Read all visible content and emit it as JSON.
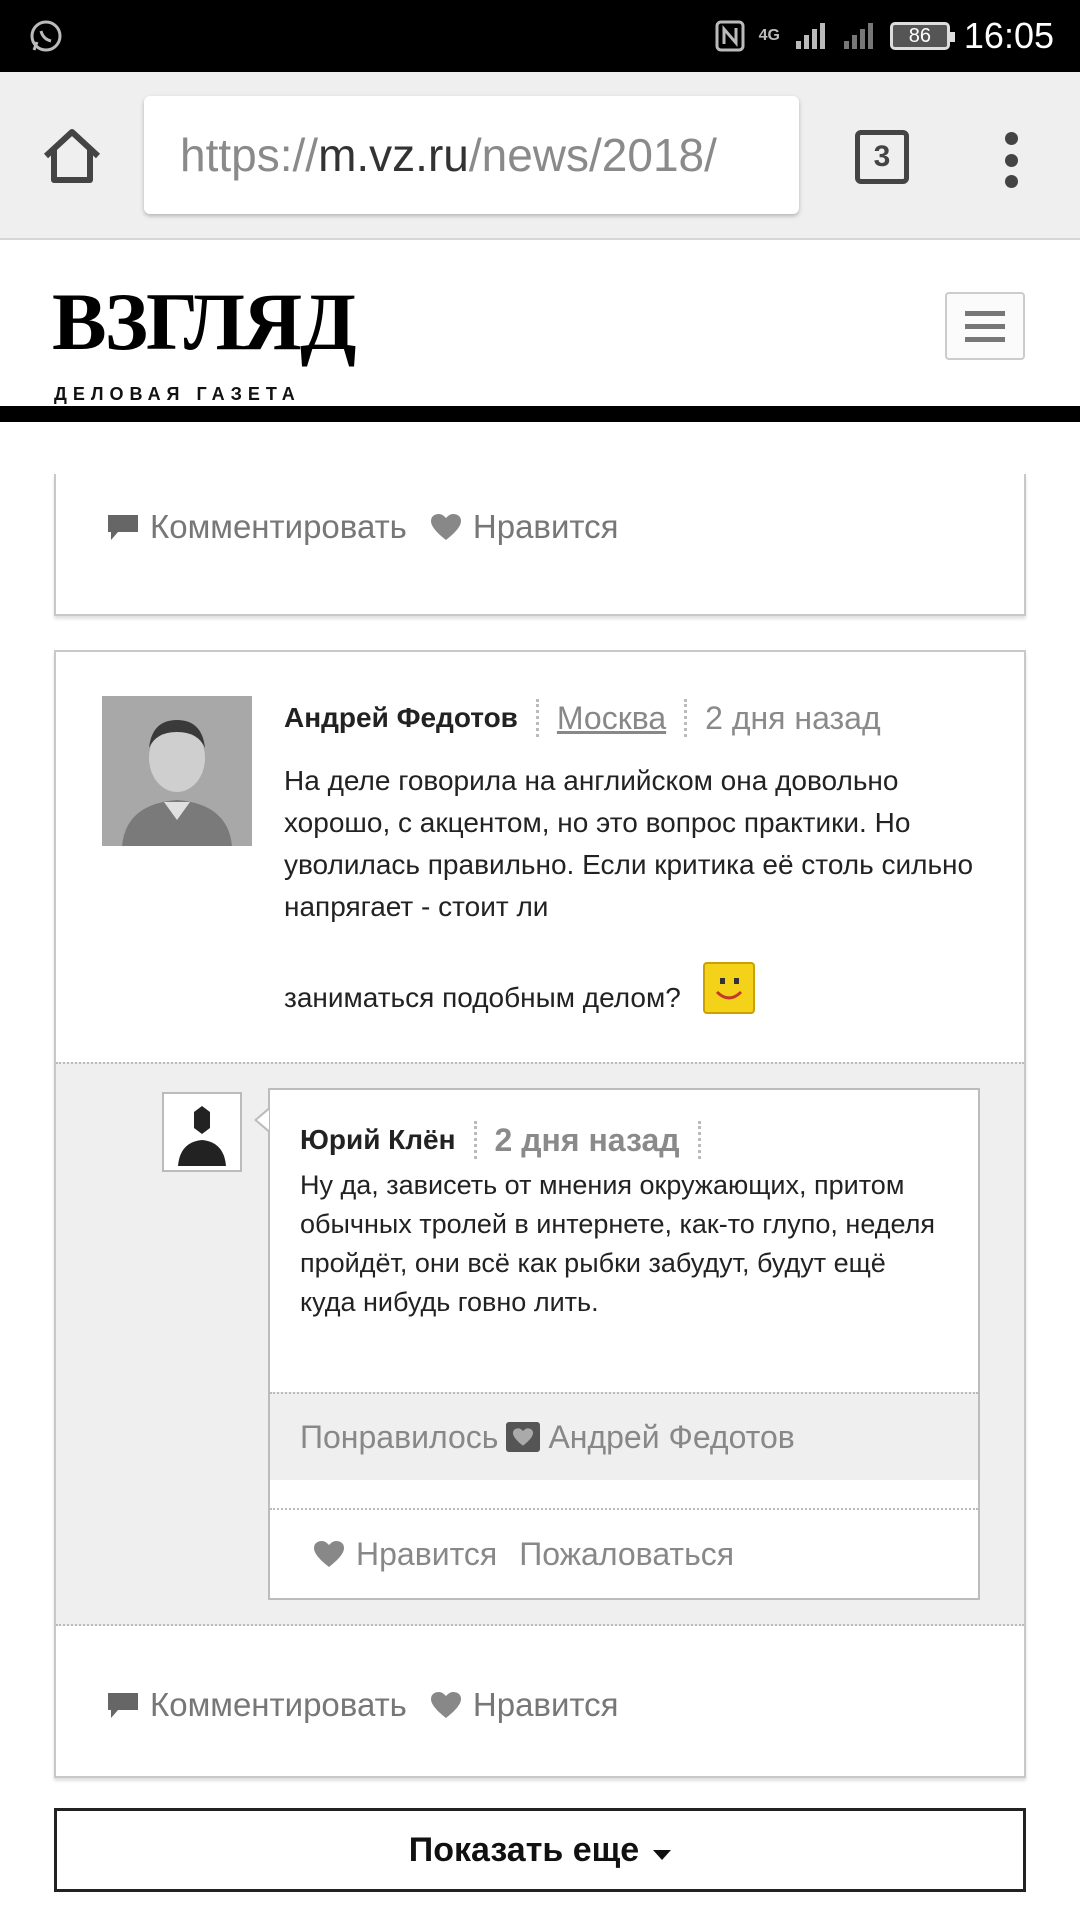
{
  "status_bar": {
    "clock": "16:05",
    "battery": "86",
    "network": "4G"
  },
  "browser": {
    "url_scheme": "https://",
    "url_host": "m.vz.ru",
    "url_path": "/news/2018/",
    "tab_count": "3"
  },
  "site": {
    "logo_main": "ВЗГЛЯД",
    "logo_sub": "ДЕЛОВАЯ ГАЗЕТА"
  },
  "top_card": {
    "comment_label": "Комментировать",
    "like_label": "Нравится"
  },
  "comment": {
    "author": "Андрей Федотов",
    "city": "Москва",
    "time": "2 дня назад",
    "text": "На деле говорила на английском она довольно хорошо, с акцентом, но это вопрос практики. Но уволилась правильно. Если критика её столь сильно напрягает - стоит ли",
    "text_last": "заниматься подобным делом?",
    "reply": {
      "author": "Юрий Клён",
      "time": "2 дня назад",
      "text": "Ну да, зависеть от мнения окружающих, притом обычных тролей в интернете, как-то глупо, неделя пройдёт, они всё как рыбки забудут, будут ещё куда нибудь говно лить.",
      "liked_label": "Понравилось",
      "liked_by": "Андрей Федотов",
      "like_label": "Нравится",
      "report_label": "Пожаловаться"
    },
    "comment_label": "Комментировать",
    "like_label": "Нравится"
  },
  "show_more": "Показать еще",
  "colors": {
    "status_bar": "#000000",
    "toolbar": "#efefef",
    "text_muted": "#888888",
    "smiley": "#f5d21a"
  }
}
